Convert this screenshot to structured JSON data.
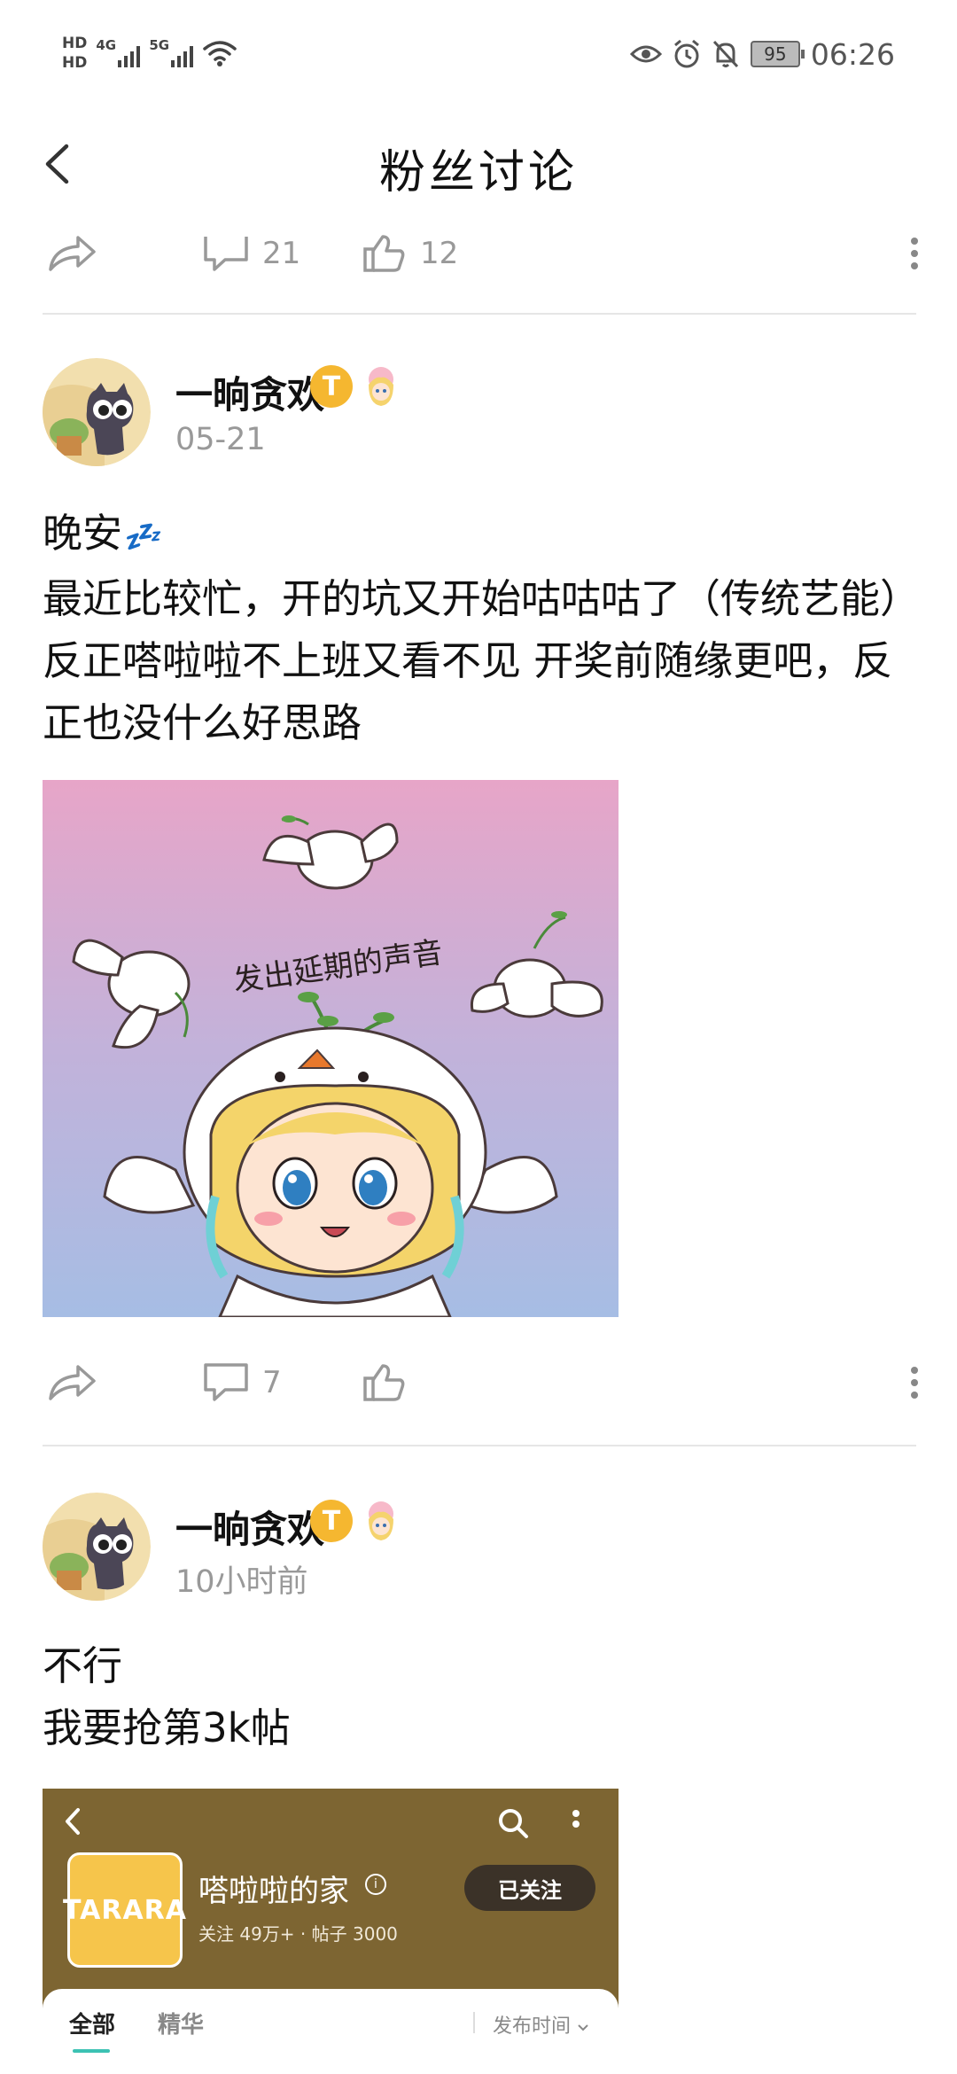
{
  "status_bar": {
    "hd1": "HD",
    "hd2": "HD",
    "net1": "4G",
    "net2": "5G",
    "battery": "95",
    "time": "06:26",
    "icons": [
      "eye-icon",
      "alarm-icon",
      "mute-bell-icon",
      "battery-icon"
    ]
  },
  "header": {
    "title": "粉丝讨论"
  },
  "prev_post_actions": {
    "comments": "21",
    "likes": "12"
  },
  "post1": {
    "author": "一晌贪欢",
    "badge": "T",
    "date": "05-21",
    "lines": [
      "晚安",
      "最近比较忙，开的坑又开始咕咕咕了（传统艺能） 反正嗒啦啦不上班又看不见 开奖前随缘更吧，反正也没什么好思路"
    ],
    "zzz": "💤",
    "image_caption": "发出延期的声音",
    "comments": "7"
  },
  "post2": {
    "author": "一晌贪欢",
    "badge": "T",
    "date": "10小时前",
    "lines": [
      "不行",
      "我要抢第3k帖"
    ],
    "screenshot": {
      "logo": "TARARA",
      "name": "嗒啦啦的家",
      "info": "i",
      "stats": "关注 49万+ · 帖子 3000",
      "follow": "已关注",
      "tab_all": "全部",
      "tab_fine": "精华",
      "sort": "发布时间"
    }
  },
  "colors": {
    "screenshot_bg": "#7d6532",
    "logo_yellow": "#f6c54b",
    "badge_gold": "#f5b730",
    "tab_accent": "#3cc2b3"
  }
}
